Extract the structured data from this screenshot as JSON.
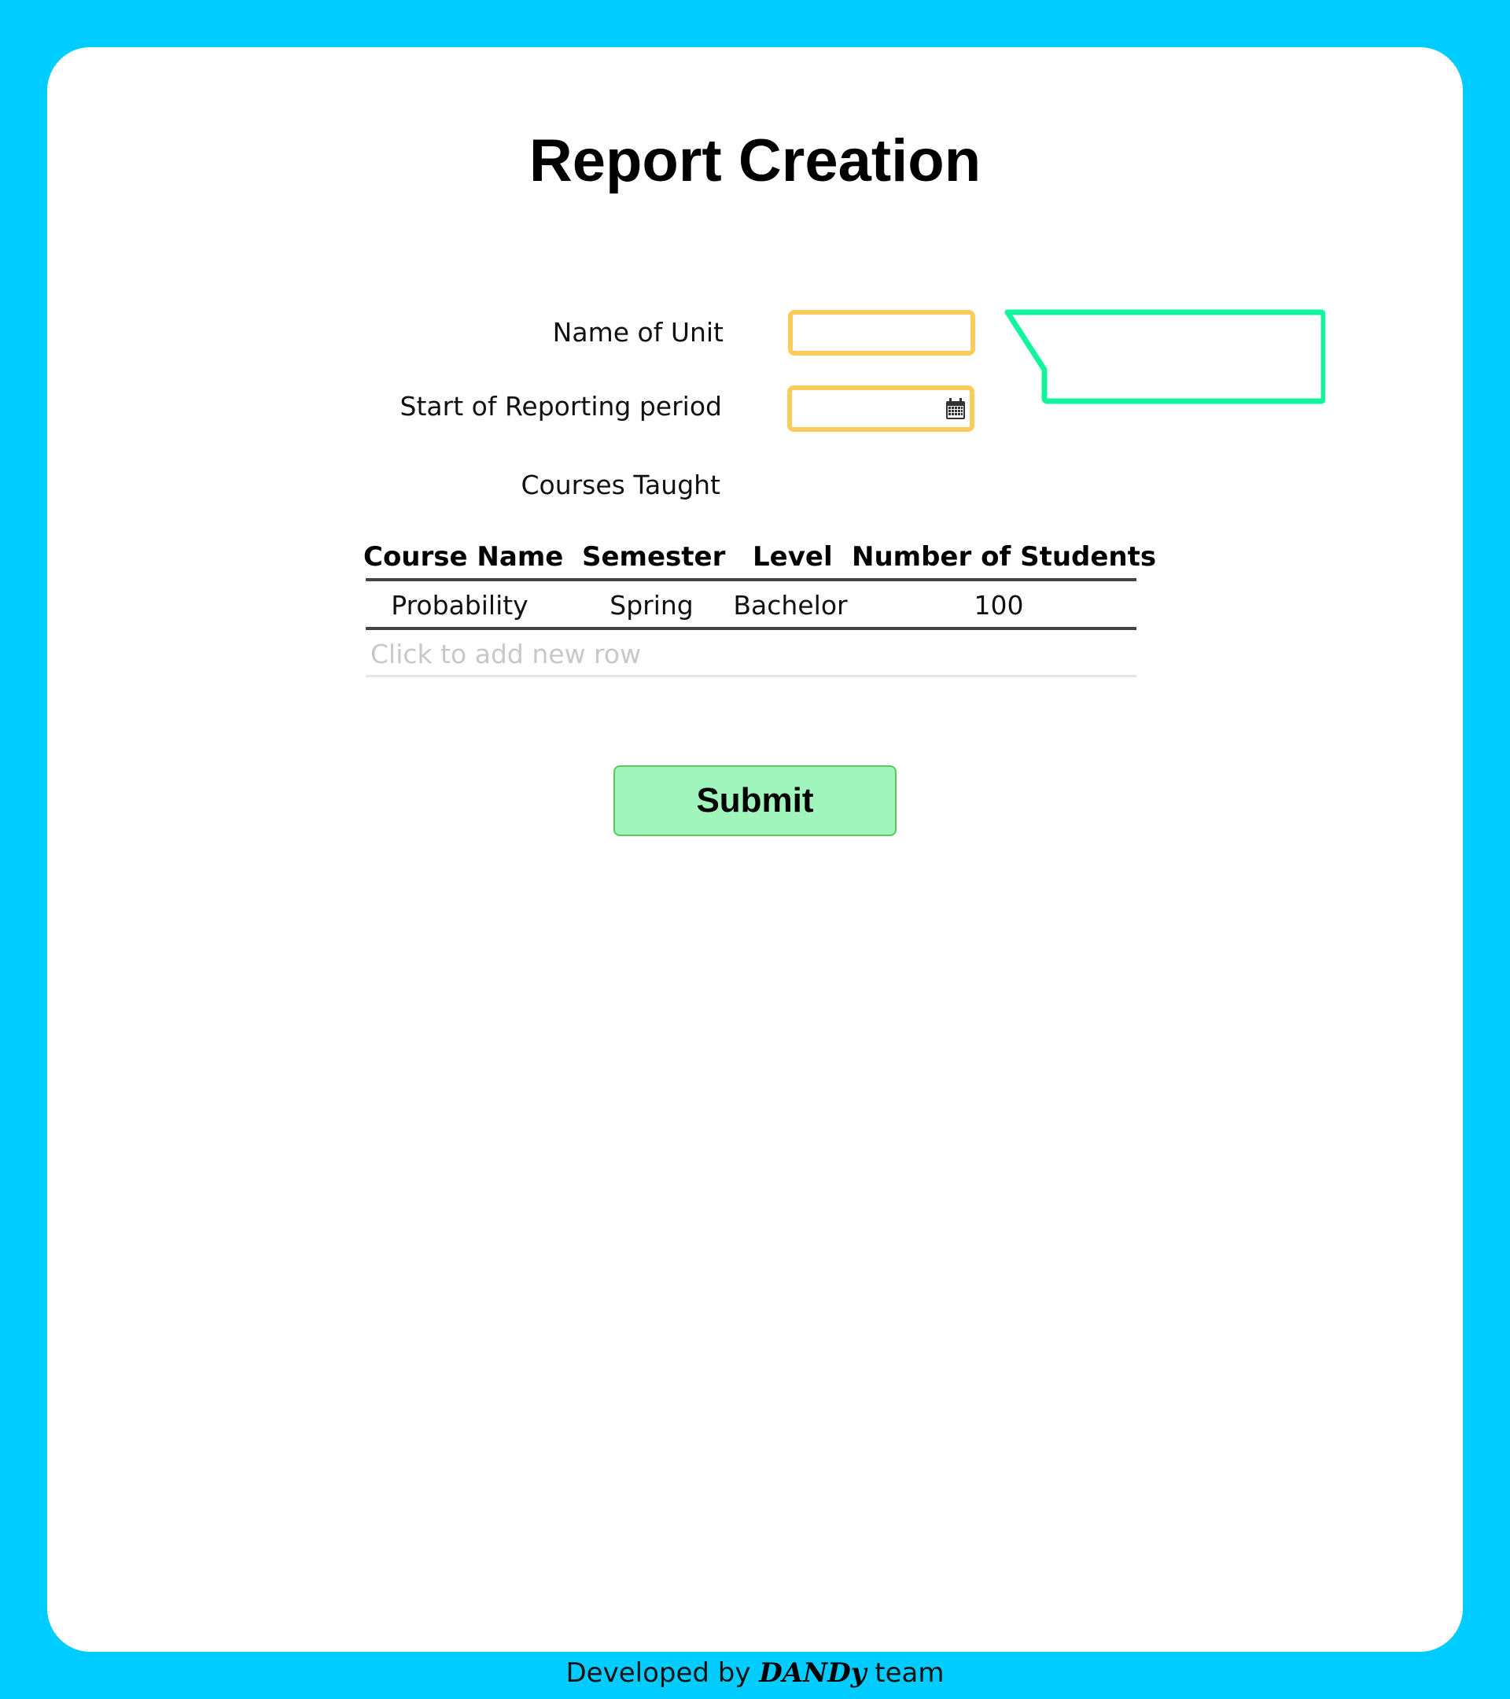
{
  "page": {
    "title": "Report Creation",
    "background_color": "#00ccff",
    "card_color": "#ffffff"
  },
  "form": {
    "name_of_unit": {
      "label": "Name of Unit",
      "value": "",
      "border_color": "#fbcb5c"
    },
    "start_of_reporting_period": {
      "label": "Start of Reporting period",
      "value": "",
      "icon": "calendar-icon",
      "border_color": "#fbcb5c"
    },
    "courses_taught": {
      "label": "Courses Taught"
    }
  },
  "callout": {
    "text": "",
    "border_color": "#13f59d"
  },
  "table": {
    "columns": [
      "Course Name",
      "Semester",
      "Level",
      "Number of Students"
    ],
    "rows": [
      [
        "Probability",
        "Spring",
        "Bachelor",
        "100"
      ]
    ],
    "add_row_placeholder": "Click to add new row"
  },
  "submit": {
    "label": "Submit",
    "color": "#a0f5bd"
  },
  "footer": {
    "prefix": "Developed by",
    "brand": "DANDy",
    "suffix": "team"
  }
}
